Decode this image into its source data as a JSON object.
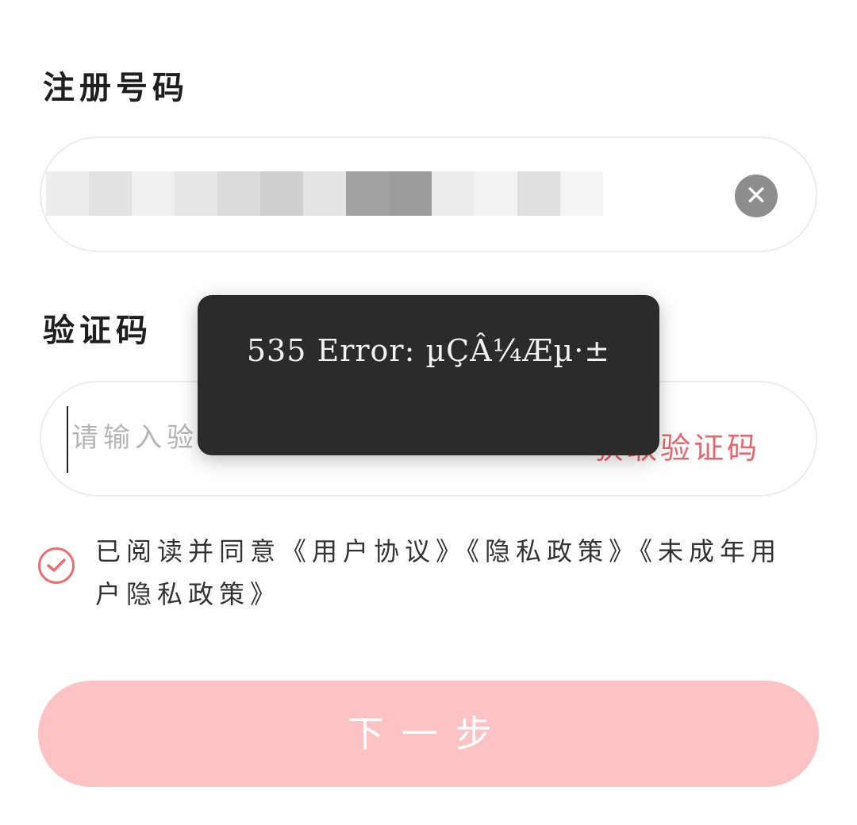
{
  "form": {
    "phone_label": "注册号码",
    "clear_icon_glyph": "✕",
    "code_label": "验证码",
    "code_placeholder": "请输入验证码",
    "get_code_label": "获取验证码",
    "agreement": {
      "prefix": "已阅读并同意",
      "user_agreement": "《用户协议》",
      "privacy_policy": "《隐私政策》",
      "minor_privacy_policy": "《未成年用户隐私政策》"
    },
    "next_label": "下一步"
  },
  "toast": {
    "message": "535 Error: µÇÂ¼Æµ·±"
  },
  "icons": {
    "clear": "close-circle-icon",
    "agree": "check-circle-icon"
  },
  "colors": {
    "accent": "#e8666e",
    "button_bg": "#fdc2c3",
    "toast_bg": "#2b2b2b"
  }
}
